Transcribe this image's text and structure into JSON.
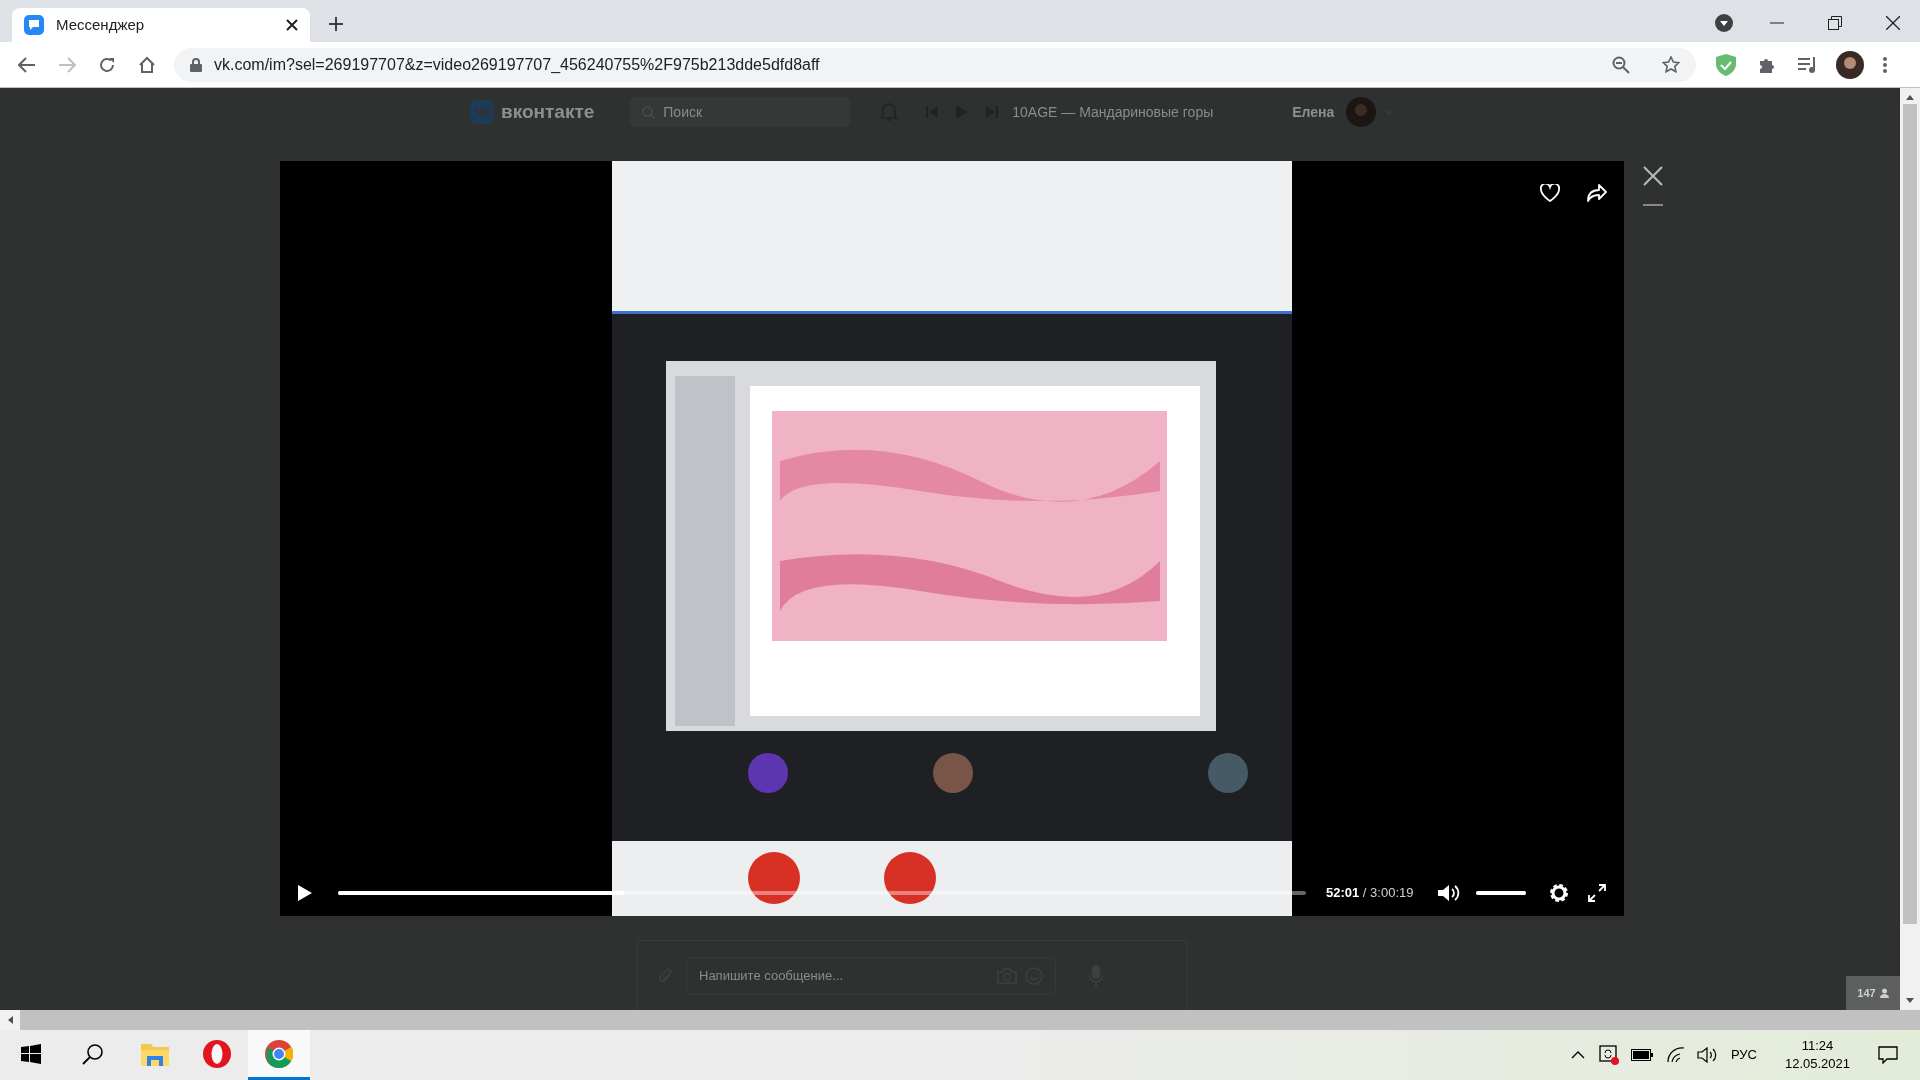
{
  "browser": {
    "tab": {
      "title": "Мессенджер",
      "selected": true
    },
    "url": "vk.com/im?sel=269197707&z=video269197707_456240755%2F975b213dde5dfd8aff"
  },
  "vk_header": {
    "logo": "вконтакте",
    "search": {
      "placeholder": "Поиск"
    },
    "now_playing": "10AGE — Мандариновые горы",
    "user": "Елена"
  },
  "player": {
    "progress": {
      "level": 0.295
    },
    "time": "**52:01** / 3:00:19",
    "volume": {
      "level": 1
    }
  },
  "composer": {
    "placeholder": "Напишите сообщение..."
  },
  "online_count": "147",
  "taskbar": {
    "apps": [
      {
        "kind": "start",
        "selected": false
      },
      {
        "kind": "search",
        "selected": false
      },
      {
        "kind": "explorer",
        "selected": false
      },
      {
        "kind": "opera",
        "selected": false
      },
      {
        "kind": "chrome",
        "selected": true
      }
    ],
    "language": "РУС",
    "time": "11:24",
    "date": "12.05.2021"
  }
}
